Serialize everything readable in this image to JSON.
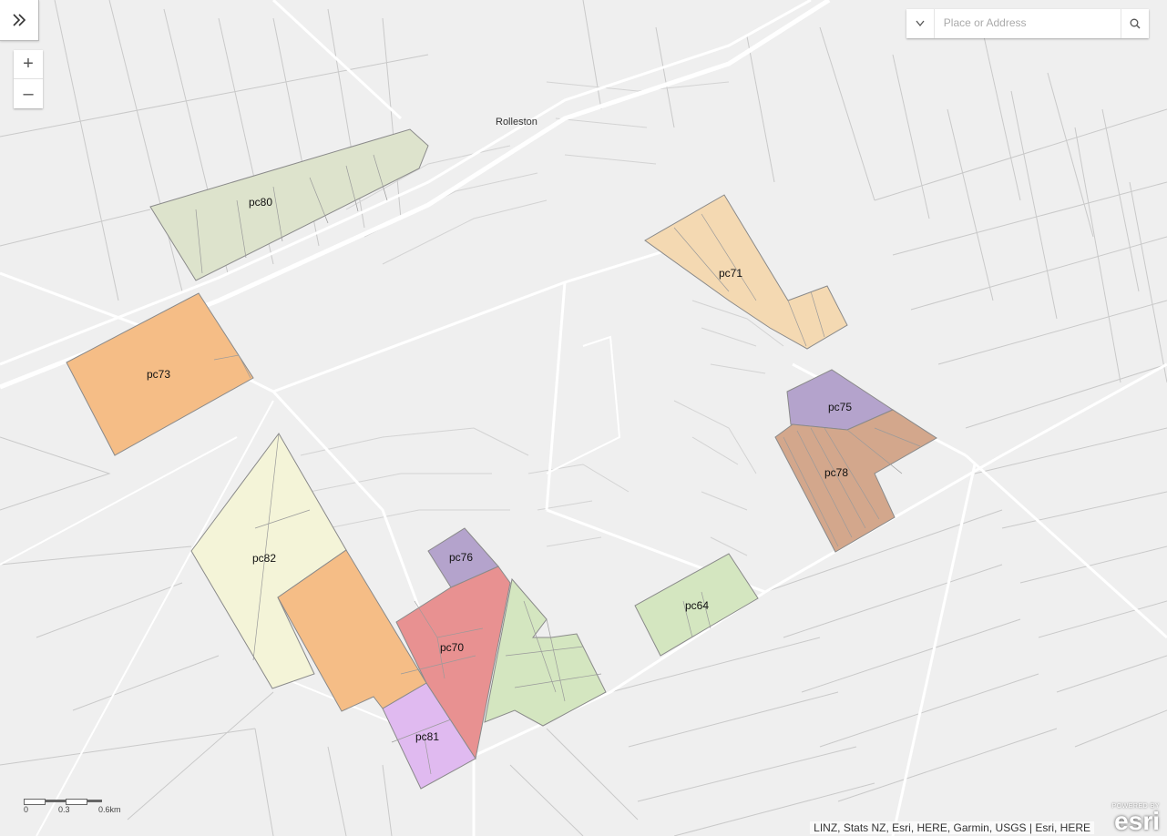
{
  "map": {
    "town_label": "Rolleston",
    "parcels": [
      {
        "id": "pc80",
        "label": "pc80",
        "color": "#dde3cc"
      },
      {
        "id": "pc71",
        "label": "pc71",
        "color": "#f4d9b2"
      },
      {
        "id": "pc73",
        "label": "pc73",
        "color": "#f5bd86"
      },
      {
        "id": "pc75",
        "label": "pc75",
        "color": "#b4a3cc"
      },
      {
        "id": "pc78",
        "label": "pc78",
        "color": "#d3a78c"
      },
      {
        "id": "pc82",
        "label": "pc82",
        "color": "#f4f4d8"
      },
      {
        "id": "pc76",
        "label": "pc76",
        "color": "#b4a3cc"
      },
      {
        "id": "pc70",
        "label": "pc70",
        "color": "#e89191"
      },
      {
        "id": "pc81",
        "label": "pc81",
        "color": "#e0baf0"
      },
      {
        "id": "pc64",
        "label": "pc64",
        "color": "#d4e6c0"
      },
      {
        "id": "unlabeled-orange",
        "label": "",
        "color": "#f5bd86"
      },
      {
        "id": "unlabeled-green",
        "label": "",
        "color": "#d4e6c0"
      }
    ]
  },
  "controls": {
    "expand_icon": "double-chevron-right-icon",
    "zoom_in_label": "+",
    "zoom_out_label": "–",
    "search_placeholder": "Place or Address",
    "search_icon": "magnifier-icon",
    "dropdown_icon": "caret-down-icon"
  },
  "scalebar": {
    "labels": [
      "0",
      "0.3",
      "0.6km"
    ]
  },
  "attribution": {
    "text": "LINZ, Stats NZ, Esri, HERE, Garmin, USGS | Esri, HERE",
    "logo_powered": "POWERED BY",
    "logo_brand": "esri"
  }
}
